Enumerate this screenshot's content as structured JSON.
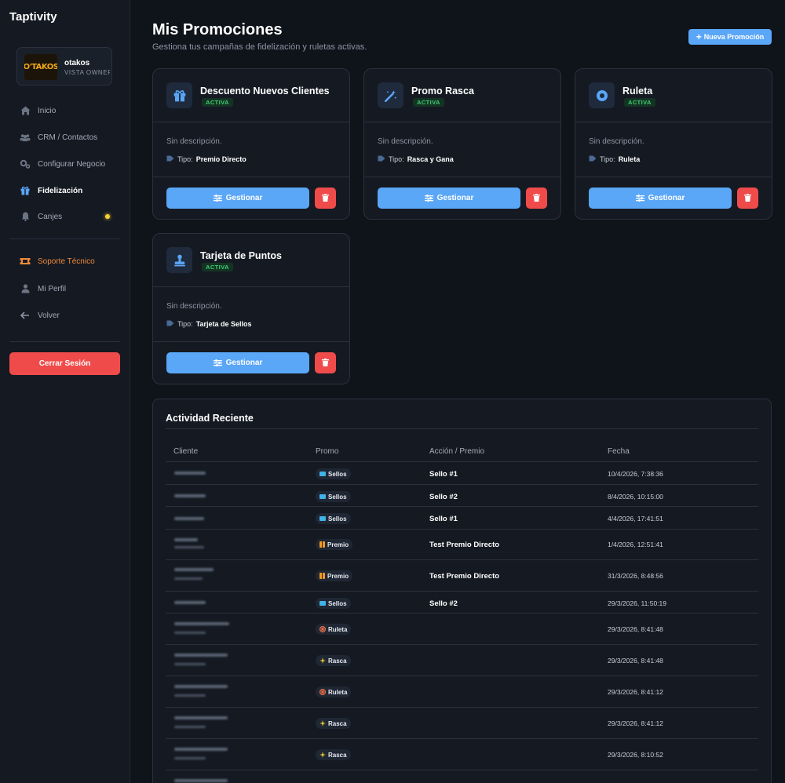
{
  "app": {
    "brand": "Taptivity"
  },
  "profile": {
    "logo_text": "O'TAKOS",
    "name": "otakos",
    "role": "VISTA OWNER"
  },
  "nav": {
    "items": [
      {
        "label": "Inicio",
        "icon": "home-icon"
      },
      {
        "label": "CRM / Contactos",
        "icon": "users-icon"
      },
      {
        "label": "Configurar Negocio",
        "icon": "gears-icon"
      },
      {
        "label": "Fidelización",
        "icon": "gift-icon"
      },
      {
        "label": "Canjes",
        "icon": "bell-icon"
      }
    ],
    "secondary": [
      {
        "label": "Soporte Técnico",
        "icon": "ticket-icon"
      },
      {
        "label": "Mi Perfil",
        "icon": "user-icon"
      },
      {
        "label": "Volver",
        "icon": "arrow-left-icon"
      }
    ],
    "logout_label": "Cerrar Sesión"
  },
  "header": {
    "title": "Mis Promociones",
    "subtitle": "Gestiona tus campañas de fidelización y ruletas activas.",
    "new_button": "Nueva Promoción"
  },
  "colors": {
    "accent": "#5aa6f7",
    "danger": "#f04b4b",
    "success": "#3fcf74",
    "support": "#f08a3a"
  },
  "promotions": [
    {
      "name": "Descuento Nuevos Clientes",
      "status": "ACTIVA",
      "description": "Sin descripción.",
      "type_label": "Tipo:",
      "type": "Premio Directo",
      "manage_label": "Gestionar",
      "icon": "gift-icon"
    },
    {
      "name": "Promo Rasca",
      "status": "ACTIVA",
      "description": "Sin descripción.",
      "type_label": "Tipo:",
      "type": "Rasca y Gana",
      "manage_label": "Gestionar",
      "icon": "magic-wand-icon"
    },
    {
      "name": "Ruleta",
      "status": "ACTIVA",
      "description": "Sin descripción.",
      "type_label": "Tipo:",
      "type": "Ruleta",
      "manage_label": "Gestionar",
      "icon": "wheel-icon"
    },
    {
      "name": "Tarjeta de Puntos",
      "status": "ACTIVA",
      "description": "Sin descripción.",
      "type_label": "Tipo:",
      "type": "Tarjeta de Sellos",
      "manage_label": "Gestionar",
      "icon": "stamp-icon"
    }
  ],
  "activity": {
    "title": "Actividad Reciente",
    "columns": [
      "Cliente",
      "Promo",
      "Acción / Premio",
      "Fecha"
    ],
    "rows": [
      {
        "promo": "Sellos",
        "promo_icon": "ticket-icon",
        "action": "Sello #1",
        "date": "10/4/2026, 7:38:36"
      },
      {
        "promo": "Sellos",
        "promo_icon": "ticket-icon",
        "action": "Sello #2",
        "date": "8/4/2026, 10:15:00"
      },
      {
        "promo": "Sellos",
        "promo_icon": "ticket-icon",
        "action": "Sello #1",
        "date": "4/4/2026, 17:41:51"
      },
      {
        "promo": "Premio",
        "promo_icon": "gift-icon",
        "action": "Test Premio Directo",
        "date": "1/4/2026, 12:51:41"
      },
      {
        "promo": "Premio",
        "promo_icon": "gift-icon",
        "action": "Test Premio Directo",
        "date": "31/3/2026, 8:48:56"
      },
      {
        "promo": "Sellos",
        "promo_icon": "ticket-icon",
        "action": "Sello #2",
        "date": "29/3/2026, 11:50:19"
      },
      {
        "promo": "Ruleta",
        "promo_icon": "wheel-icon",
        "action": "",
        "date": "29/3/2026, 8:41:48"
      },
      {
        "promo": "Rasca",
        "promo_icon": "sparkle-icon",
        "action": "",
        "date": "29/3/2026, 8:41:48"
      },
      {
        "promo": "Ruleta",
        "promo_icon": "wheel-icon",
        "action": "",
        "date": "29/3/2026, 8:41:12"
      },
      {
        "promo": "Rasca",
        "promo_icon": "sparkle-icon",
        "action": "",
        "date": "29/3/2026, 8:41:12"
      },
      {
        "promo": "Rasca",
        "promo_icon": "sparkle-icon",
        "action": "",
        "date": "29/3/2026, 8:10:52"
      }
    ]
  }
}
